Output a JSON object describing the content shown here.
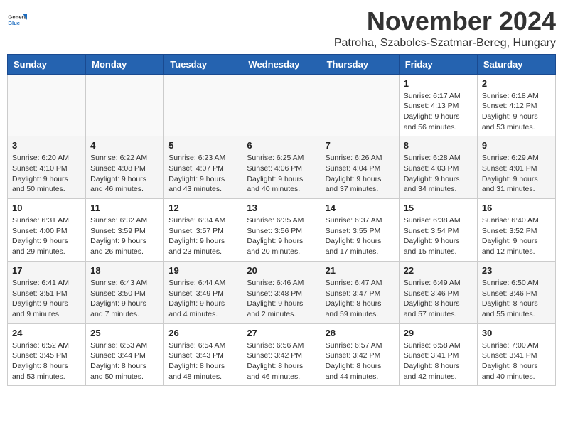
{
  "logo": {
    "general": "General",
    "blue": "Blue"
  },
  "header": {
    "month": "November 2024",
    "location": "Patroha, Szabolcs-Szatmar-Bereg, Hungary"
  },
  "days_of_week": [
    "Sunday",
    "Monday",
    "Tuesday",
    "Wednesday",
    "Thursday",
    "Friday",
    "Saturday"
  ],
  "weeks": [
    [
      {
        "day": "",
        "info": ""
      },
      {
        "day": "",
        "info": ""
      },
      {
        "day": "",
        "info": ""
      },
      {
        "day": "",
        "info": ""
      },
      {
        "day": "",
        "info": ""
      },
      {
        "day": "1",
        "info": "Sunrise: 6:17 AM\nSunset: 4:13 PM\nDaylight: 9 hours and 56 minutes."
      },
      {
        "day": "2",
        "info": "Sunrise: 6:18 AM\nSunset: 4:12 PM\nDaylight: 9 hours and 53 minutes."
      }
    ],
    [
      {
        "day": "3",
        "info": "Sunrise: 6:20 AM\nSunset: 4:10 PM\nDaylight: 9 hours and 50 minutes."
      },
      {
        "day": "4",
        "info": "Sunrise: 6:22 AM\nSunset: 4:08 PM\nDaylight: 9 hours and 46 minutes."
      },
      {
        "day": "5",
        "info": "Sunrise: 6:23 AM\nSunset: 4:07 PM\nDaylight: 9 hours and 43 minutes."
      },
      {
        "day": "6",
        "info": "Sunrise: 6:25 AM\nSunset: 4:06 PM\nDaylight: 9 hours and 40 minutes."
      },
      {
        "day": "7",
        "info": "Sunrise: 6:26 AM\nSunset: 4:04 PM\nDaylight: 9 hours and 37 minutes."
      },
      {
        "day": "8",
        "info": "Sunrise: 6:28 AM\nSunset: 4:03 PM\nDaylight: 9 hours and 34 minutes."
      },
      {
        "day": "9",
        "info": "Sunrise: 6:29 AM\nSunset: 4:01 PM\nDaylight: 9 hours and 31 minutes."
      }
    ],
    [
      {
        "day": "10",
        "info": "Sunrise: 6:31 AM\nSunset: 4:00 PM\nDaylight: 9 hours and 29 minutes."
      },
      {
        "day": "11",
        "info": "Sunrise: 6:32 AM\nSunset: 3:59 PM\nDaylight: 9 hours and 26 minutes."
      },
      {
        "day": "12",
        "info": "Sunrise: 6:34 AM\nSunset: 3:57 PM\nDaylight: 9 hours and 23 minutes."
      },
      {
        "day": "13",
        "info": "Sunrise: 6:35 AM\nSunset: 3:56 PM\nDaylight: 9 hours and 20 minutes."
      },
      {
        "day": "14",
        "info": "Sunrise: 6:37 AM\nSunset: 3:55 PM\nDaylight: 9 hours and 17 minutes."
      },
      {
        "day": "15",
        "info": "Sunrise: 6:38 AM\nSunset: 3:54 PM\nDaylight: 9 hours and 15 minutes."
      },
      {
        "day": "16",
        "info": "Sunrise: 6:40 AM\nSunset: 3:52 PM\nDaylight: 9 hours and 12 minutes."
      }
    ],
    [
      {
        "day": "17",
        "info": "Sunrise: 6:41 AM\nSunset: 3:51 PM\nDaylight: 9 hours and 9 minutes."
      },
      {
        "day": "18",
        "info": "Sunrise: 6:43 AM\nSunset: 3:50 PM\nDaylight: 9 hours and 7 minutes."
      },
      {
        "day": "19",
        "info": "Sunrise: 6:44 AM\nSunset: 3:49 PM\nDaylight: 9 hours and 4 minutes."
      },
      {
        "day": "20",
        "info": "Sunrise: 6:46 AM\nSunset: 3:48 PM\nDaylight: 9 hours and 2 minutes."
      },
      {
        "day": "21",
        "info": "Sunrise: 6:47 AM\nSunset: 3:47 PM\nDaylight: 8 hours and 59 minutes."
      },
      {
        "day": "22",
        "info": "Sunrise: 6:49 AM\nSunset: 3:46 PM\nDaylight: 8 hours and 57 minutes."
      },
      {
        "day": "23",
        "info": "Sunrise: 6:50 AM\nSunset: 3:46 PM\nDaylight: 8 hours and 55 minutes."
      }
    ],
    [
      {
        "day": "24",
        "info": "Sunrise: 6:52 AM\nSunset: 3:45 PM\nDaylight: 8 hours and 53 minutes."
      },
      {
        "day": "25",
        "info": "Sunrise: 6:53 AM\nSunset: 3:44 PM\nDaylight: 8 hours and 50 minutes."
      },
      {
        "day": "26",
        "info": "Sunrise: 6:54 AM\nSunset: 3:43 PM\nDaylight: 8 hours and 48 minutes."
      },
      {
        "day": "27",
        "info": "Sunrise: 6:56 AM\nSunset: 3:42 PM\nDaylight: 8 hours and 46 minutes."
      },
      {
        "day": "28",
        "info": "Sunrise: 6:57 AM\nSunset: 3:42 PM\nDaylight: 8 hours and 44 minutes."
      },
      {
        "day": "29",
        "info": "Sunrise: 6:58 AM\nSunset: 3:41 PM\nDaylight: 8 hours and 42 minutes."
      },
      {
        "day": "30",
        "info": "Sunrise: 7:00 AM\nSunset: 3:41 PM\nDaylight: 8 hours and 40 minutes."
      }
    ]
  ]
}
